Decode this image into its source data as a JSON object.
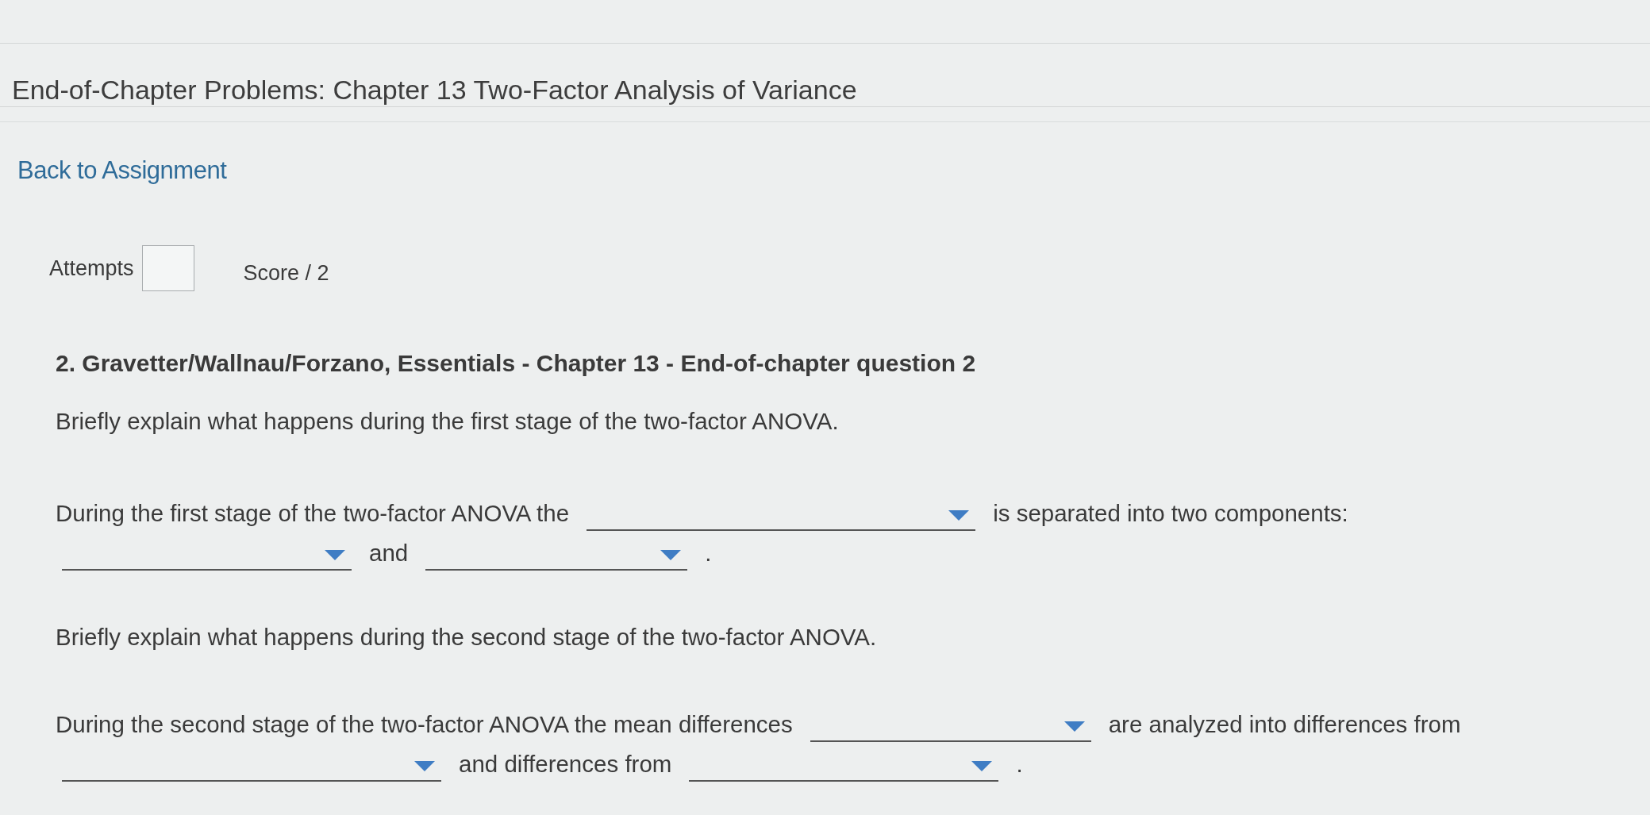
{
  "page": {
    "title": "End-of-Chapter Problems: Chapter 13 Two-Factor Analysis of Variance",
    "back_link": "Back to Assignment"
  },
  "score_bar": {
    "attempts_label": "Attempts",
    "score_label": "Score / 2"
  },
  "question": {
    "heading": "2. Gravetter/Wallnau/Forzano, Essentials - Chapter 13 - End-of-chapter question 2",
    "parts": [
      {
        "prompt": "Briefly explain what happens during the first stage of the two-factor ANOVA.",
        "answer_lines": [
          [
            {
              "kind": "text",
              "text": "During the first stage of the two-factor ANOVA the"
            },
            {
              "kind": "dropdown"
            },
            {
              "kind": "text",
              "text": "is separated into two components:"
            }
          ],
          [
            {
              "kind": "dropdown"
            },
            {
              "kind": "text",
              "text": "and"
            },
            {
              "kind": "dropdown"
            },
            {
              "kind": "text",
              "text": "."
            }
          ]
        ]
      },
      {
        "prompt": "Briefly explain what happens during the second stage of the two-factor ANOVA.",
        "answer_lines": [
          [
            {
              "kind": "text",
              "text": "During the second stage of the two-factor ANOVA the mean differences"
            },
            {
              "kind": "dropdown"
            },
            {
              "kind": "text",
              "text": "are analyzed into differences from"
            }
          ],
          [
            {
              "kind": "dropdown"
            },
            {
              "kind": "text",
              "text": "and differences from"
            },
            {
              "kind": "dropdown"
            },
            {
              "kind": "text",
              "text": "."
            }
          ]
        ]
      }
    ]
  }
}
